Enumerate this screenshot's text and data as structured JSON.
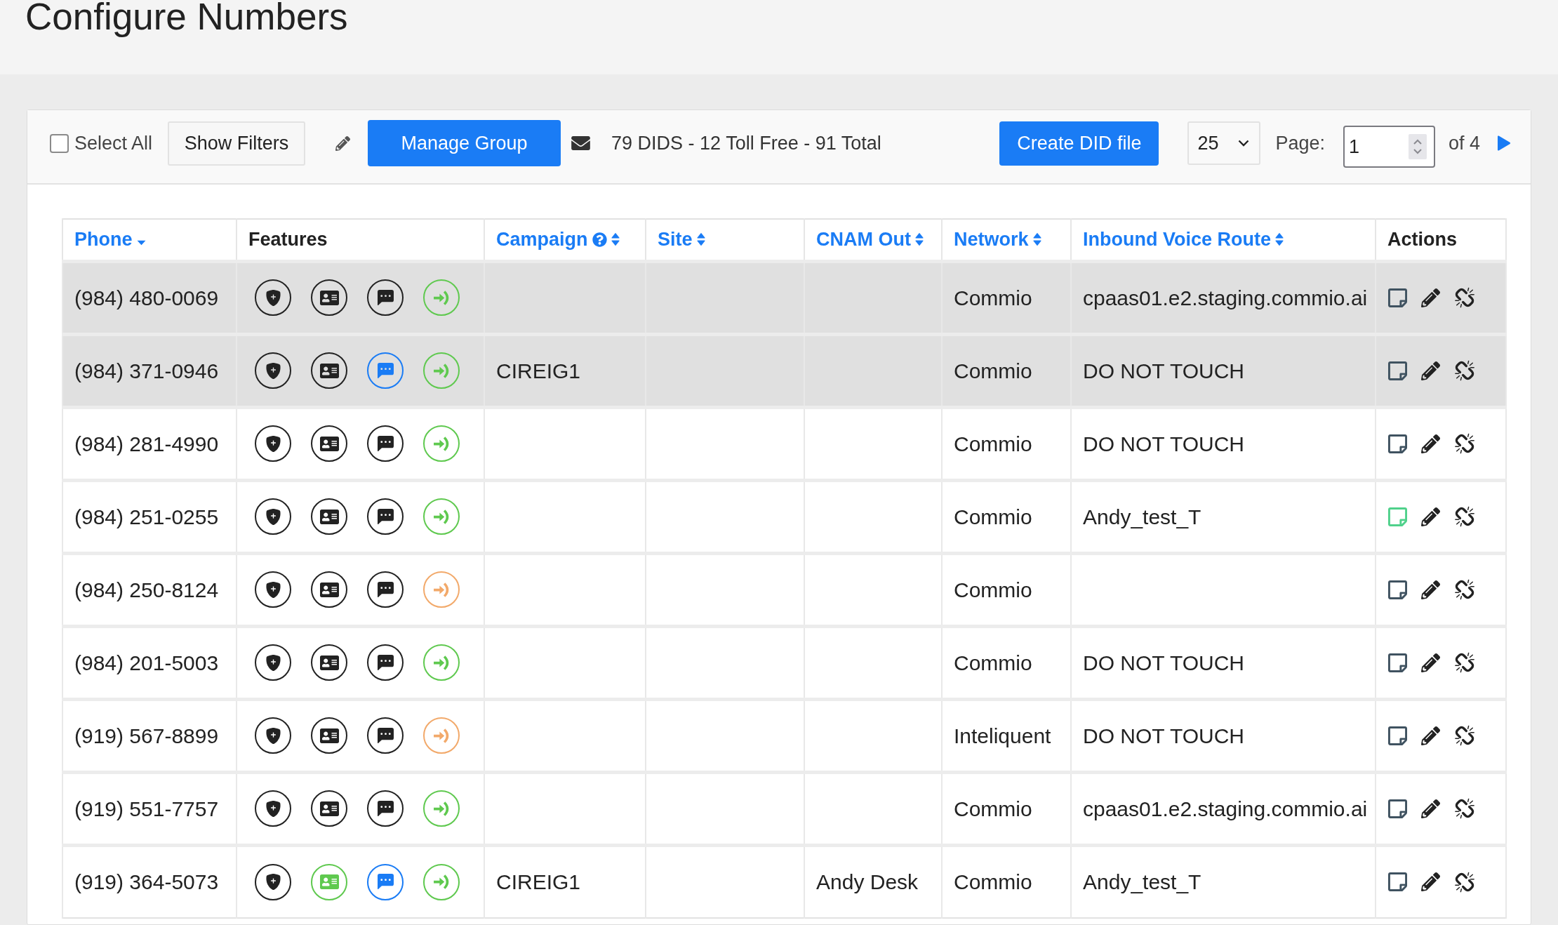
{
  "page": {
    "title": "Configure Numbers"
  },
  "toolbar": {
    "select_all": {
      "label": "Select All",
      "checked": false
    },
    "show_filters": "Show Filters",
    "manage_group": "Manage Group",
    "summary": "79 DIDS - 12 Toll Free - 91 Total",
    "create_did_file": "Create DID file",
    "per_page": "25",
    "page_label": "Page:",
    "page": "1",
    "page_total": "of 4"
  },
  "table": {
    "columns": [
      {
        "label": "Phone",
        "sortable": true,
        "sorted": true,
        "help": false
      },
      {
        "label": "Features",
        "sortable": false,
        "sorted": false,
        "help": false
      },
      {
        "label": "Campaign",
        "sortable": true,
        "sorted": false,
        "help": true
      },
      {
        "label": "Site",
        "sortable": true,
        "sorted": false,
        "help": false
      },
      {
        "label": "CNAM Out",
        "sortable": true,
        "sorted": false,
        "help": false
      },
      {
        "label": "Network",
        "sortable": true,
        "sorted": false,
        "help": false
      },
      {
        "label": "Inbound Voice Route",
        "sortable": true,
        "sorted": false,
        "help": false
      },
      {
        "label": "Actions",
        "sortable": false,
        "sorted": false,
        "help": false
      }
    ],
    "rows": [
      {
        "phone": "(984) 480-0069",
        "selected": true,
        "features": [
          {
            "kind": "shield",
            "color": "#222222"
          },
          {
            "kind": "card",
            "color": "#222222"
          },
          {
            "kind": "chat",
            "color": "#222222"
          },
          {
            "kind": "inbound",
            "color": "#5fc94f"
          }
        ],
        "network": "Commio",
        "inbound_voice_route": "cpaas01.e2.staging.commio.ai",
        "has_note": false
      },
      {
        "phone": "(984) 371-0946",
        "selected": true,
        "features": [
          {
            "kind": "shield",
            "color": "#222222"
          },
          {
            "kind": "card",
            "color": "#222222"
          },
          {
            "kind": "chat",
            "color": "#1a7cf5"
          },
          {
            "kind": "inbound",
            "color": "#5fc94f"
          }
        ],
        "campaign": "CIREIG1",
        "network": "Commio",
        "inbound_voice_route": "DO NOT TOUCH",
        "has_note": false
      },
      {
        "phone": "(984) 281-4990",
        "selected": false,
        "features": [
          {
            "kind": "shield",
            "color": "#222222"
          },
          {
            "kind": "card",
            "color": "#222222"
          },
          {
            "kind": "chat",
            "color": "#222222"
          },
          {
            "kind": "inbound",
            "color": "#5fc94f"
          }
        ],
        "network": "Commio",
        "inbound_voice_route": "DO NOT TOUCH",
        "has_note": false
      },
      {
        "phone": "(984) 251-0255",
        "selected": false,
        "features": [
          {
            "kind": "shield",
            "color": "#222222"
          },
          {
            "kind": "card",
            "color": "#222222"
          },
          {
            "kind": "chat",
            "color": "#222222"
          },
          {
            "kind": "inbound",
            "color": "#5fc94f"
          }
        ],
        "network": "Commio",
        "inbound_voice_route": "Andy_test_T",
        "has_note": true
      },
      {
        "phone": "(984) 250-8124",
        "selected": false,
        "features": [
          {
            "kind": "shield",
            "color": "#222222"
          },
          {
            "kind": "card",
            "color": "#222222"
          },
          {
            "kind": "chat",
            "color": "#222222"
          },
          {
            "kind": "inbound",
            "color": "#f2a96a"
          }
        ],
        "network": "Commio",
        "has_note": false
      },
      {
        "phone": "(984) 201-5003",
        "selected": false,
        "features": [
          {
            "kind": "shield",
            "color": "#222222"
          },
          {
            "kind": "card",
            "color": "#222222"
          },
          {
            "kind": "chat",
            "color": "#222222"
          },
          {
            "kind": "inbound",
            "color": "#5fc94f"
          }
        ],
        "network": "Commio",
        "inbound_voice_route": "DO NOT TOUCH",
        "has_note": false
      },
      {
        "phone": "(919) 567-8899",
        "selected": false,
        "features": [
          {
            "kind": "shield",
            "color": "#222222"
          },
          {
            "kind": "card",
            "color": "#222222"
          },
          {
            "kind": "chat",
            "color": "#222222"
          },
          {
            "kind": "inbound",
            "color": "#f2a96a"
          }
        ],
        "network": "Inteliquent",
        "inbound_voice_route": "DO NOT TOUCH",
        "has_note": false
      },
      {
        "phone": "(919) 551-7757",
        "selected": false,
        "features": [
          {
            "kind": "shield",
            "color": "#222222"
          },
          {
            "kind": "card",
            "color": "#222222"
          },
          {
            "kind": "chat",
            "color": "#222222"
          },
          {
            "kind": "inbound",
            "color": "#5fc94f"
          }
        ],
        "network": "Commio",
        "inbound_voice_route": "cpaas01.e2.staging.commio.ai",
        "has_note": false
      },
      {
        "phone": "(919) 364-5073",
        "selected": false,
        "features": [
          {
            "kind": "shield",
            "color": "#222222"
          },
          {
            "kind": "card",
            "color": "#5fc94f"
          },
          {
            "kind": "chat",
            "color": "#1a7cf5"
          },
          {
            "kind": "inbound",
            "color": "#5fc94f"
          }
        ],
        "campaign": "CIREIG1",
        "cnam_out": "Andy Desk",
        "network": "Commio",
        "inbound_voice_route": "Andy_test_T",
        "has_note": false
      }
    ]
  }
}
